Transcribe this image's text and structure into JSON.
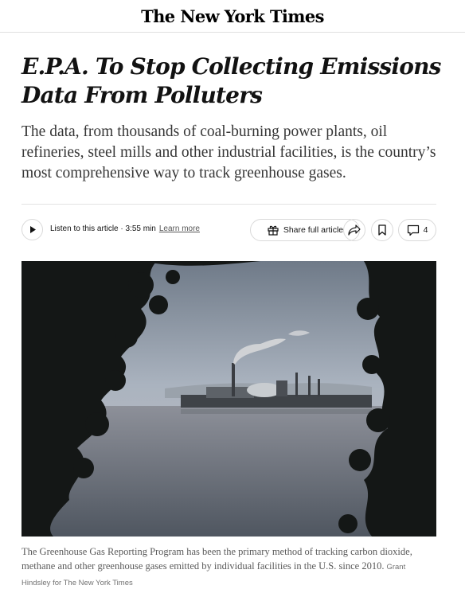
{
  "masthead": {
    "logo": "The New York Times"
  },
  "article": {
    "headline": "E.P.A. To Stop Collecting Emissions Data From Polluters",
    "summary": "The data, from thousands of coal-burning power plants, oil refineries, steel mills and other industrial facilities, is the country’s most comprehensive way to track greenhouse gases."
  },
  "toolbar": {
    "listen_label": "Listen to this article · 3:55 min",
    "learn_more": "Learn more",
    "share_label": "Share full article",
    "comment_count": "4",
    "icons": [
      "play-icon",
      "gift-icon",
      "share-icon",
      "bookmark-icon",
      "comment-icon"
    ]
  },
  "photo": {
    "caption": "The Greenhouse Gas Reporting Program has been the primary method of tracking carbon dioxide, methane and other greenhouse gases emitted by individual facilities in the U.S. since 2010.",
    "credit": "Grant Hindsley for The New York Times"
  },
  "colors": {
    "text": "#121212",
    "summary": "#363636",
    "caption": "#5a5a5a",
    "border": "#d9d9d9"
  }
}
